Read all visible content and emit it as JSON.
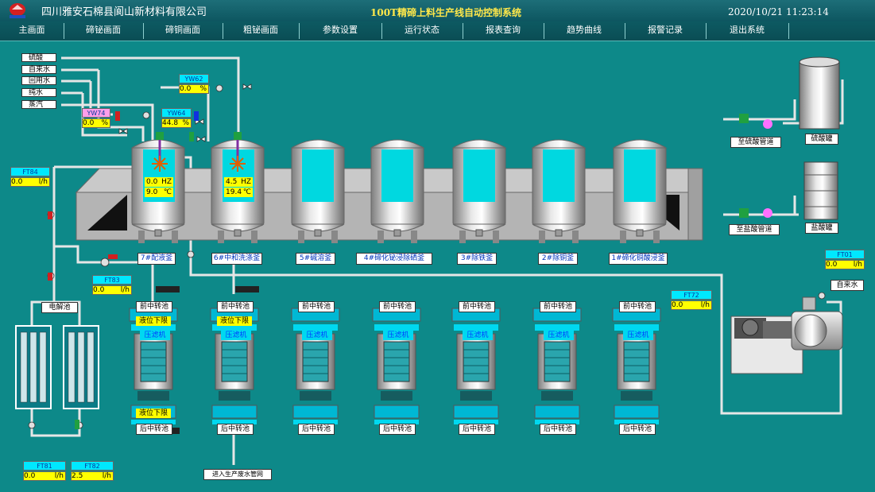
{
  "header": {
    "company": "四川雅安石棉县阆山新材料有限公司",
    "system_title": "100T精碲上料生产线自动控制系统",
    "datetime": "2020/10/21 11:23:14"
  },
  "nav": [
    {
      "label": "主画面"
    },
    {
      "label": "碲铋画面"
    },
    {
      "label": "碲铜画面"
    },
    {
      "label": "粗铋画面"
    },
    {
      "label": "参数设置"
    },
    {
      "label": "运行状态"
    },
    {
      "label": "报表查询"
    },
    {
      "label": "趋势曲线"
    },
    {
      "label": "报警记录"
    },
    {
      "label": "退出系统"
    }
  ],
  "inlets": [
    "硫酸",
    "自来水",
    "回用水",
    "纯水",
    "蒸汽"
  ],
  "sensors": {
    "yw62": {
      "tag": "YW62",
      "value": "0.0",
      "unit": "%"
    },
    "yw74": {
      "tag": "YW74",
      "value": "0.0",
      "unit": "%"
    },
    "yw64": {
      "tag": "YW64",
      "value": "44.8",
      "unit": "%"
    },
    "ft84": {
      "tag": "FT84",
      "value": "0.0",
      "unit": "l/h"
    },
    "ft83": {
      "tag": "FT83",
      "value": "0.0",
      "unit": "l/h"
    },
    "ft81": {
      "tag": "FT81",
      "value": "0.0",
      "unit": "l/h"
    },
    "ft82": {
      "tag": "FT82",
      "value": "2.5",
      "unit": "l/h"
    },
    "ft72": {
      "tag": "FT72",
      "value": "0.0",
      "unit": "l/h"
    },
    "ft01": {
      "tag": "FT01",
      "value": "0.0",
      "unit": "l/h"
    }
  },
  "tank7": {
    "freq": "0.0",
    "freq_unit": "HZ",
    "temp": "9.0",
    "temp_unit": "℃"
  },
  "tank6": {
    "freq": "4.5",
    "freq_unit": "HZ",
    "temp": "19.4",
    "temp_unit": "℃"
  },
  "tanks": [
    {
      "label": "7#配液釜"
    },
    {
      "label": "6#中和洗涤釜"
    },
    {
      "label": "5#碱溶釜"
    },
    {
      "label": "4#碲化铋浸除硒釜"
    },
    {
      "label": "3#除铁釜"
    },
    {
      "label": "2#除铜釜"
    },
    {
      "label": "1#碲化铜酸浸釜"
    }
  ],
  "pools": {
    "front": "前中转池",
    "rear": "后中转池"
  },
  "press_label": "压滤机",
  "level_warning": "液位下限",
  "electrolysis": "电解池",
  "right": {
    "acid_tank": "硫酸罐",
    "hcl_tank": "盐酸罐",
    "to_acid": "至硫酸管道",
    "to_hcl": "至盐酸管道",
    "tap_water": "自来水"
  },
  "waste_pipe": "进入生产废水管网",
  "colors": {
    "background": "#0d8989",
    "pipe": "#e6e6e6",
    "tag_cyan": "#00e8ff",
    "value_yellow": "#ffff00",
    "tag_pink": "#ff9eea",
    "title_yellow": "#ffe84a"
  }
}
